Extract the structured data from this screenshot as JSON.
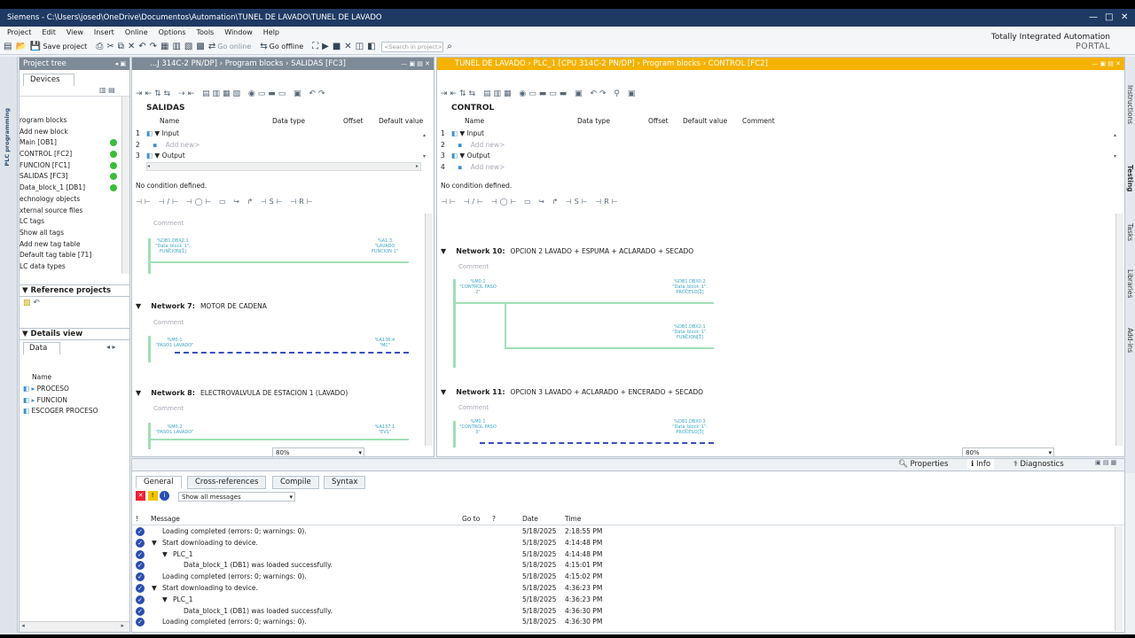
{
  "window": {
    "title": "Siemens  -  C:\\Users\\josed\\OneDrive\\Documentos\\Automation\\TUNEL DE LAVADO\\TUNEL DE LAVADO"
  },
  "menu": [
    "Project",
    "Edit",
    "View",
    "Insert",
    "Online",
    "Options",
    "Tools",
    "Window",
    "Help"
  ],
  "toolbar": {
    "save_label": "Save project",
    "go_online": "Go online",
    "go_offline": "Go offline",
    "search_placeholder": "<Search in project>"
  },
  "brand": {
    "line1": "Totally Integrated Automation",
    "line2": "PORTAL"
  },
  "sidebar_tab": "PLC programming",
  "project_tree": {
    "title": "Project tree",
    "tab": "Devices",
    "items": [
      {
        "label": "rogram blocks",
        "status": false
      },
      {
        "label": "Add new block",
        "status": false
      },
      {
        "label": "Main [OB1]",
        "status": true
      },
      {
        "label": "CONTROL [FC2]",
        "status": true
      },
      {
        "label": "FUNCION [FC1]",
        "status": true
      },
      {
        "label": "SALIDAS [FC3]",
        "status": true
      },
      {
        "label": "Data_block_1 [DB1]",
        "status": true
      },
      {
        "label": "echnology objects",
        "status": false
      },
      {
        "label": "xternal source files",
        "status": false
      },
      {
        "label": "LC tags",
        "status": false
      },
      {
        "label": "Show all tags",
        "status": false
      },
      {
        "label": "Add new tag table",
        "status": false
      },
      {
        "label": "Default tag table [71]",
        "status": false
      },
      {
        "label": "LC data types",
        "status": false
      }
    ]
  },
  "reference_projects": {
    "title": "Reference projects"
  },
  "details_view": {
    "title": "Details view",
    "tab": "Data",
    "col": "Name",
    "items": [
      "PROCESO",
      "FUNCION",
      "ESCOGER PROCESO"
    ]
  },
  "editor_left": {
    "breadcrumb": "...J 314C-2 PN/DP]  ›  Program blocks  ›  SALIDAS [FC3]",
    "block_name": "SALIDAS",
    "cols": [
      "Name",
      "Data type",
      "Offset",
      "Default value"
    ],
    "rows": [
      "Input",
      "Add new>",
      "Output"
    ],
    "condition": "No condition defined.",
    "zoom": "80%",
    "networks": [
      {
        "num": "Network 7:",
        "title": "MOTOR DE CADENA"
      },
      {
        "num": "Network 8:",
        "title": "ELECTROVALVULA DE ESTACION 1 (LAVADO)"
      }
    ],
    "comment": "Comment",
    "tags": {
      "t1": "%DB1.DBX2.1\n\"Data_block_1\".\nFUNCION[1]",
      "t2": "%A1.3\n\"LAVADO\nFUNCION 1\"",
      "t3": "%M0.1\n\"PASO1 LAVADO\"",
      "t4": "%A136.4\n\"MC\"",
      "t5": "%M0.2\n\"PASO1 LAVADO\"",
      "t6": "%A137.1\n\"EV1\""
    }
  },
  "editor_right": {
    "breadcrumb": "TUNEL DE LAVADO  ›  PLC_1 [CPU 314C-2 PN/DP]  ›  Program blocks  ›  CONTROL [FC2]",
    "block_name": "CONTROL",
    "cols": [
      "Name",
      "Data type",
      "Offset",
      "Default value",
      "Comment"
    ],
    "rows": [
      "Input",
      "Add new>",
      "Output",
      "Add new>"
    ],
    "condition": "No condition defined.",
    "zoom": "80%",
    "networks": [
      {
        "num": "Network 10:",
        "title": "OPCION 2 LAVADO + ESPUMA + ACLARADO + SECADO"
      },
      {
        "num": "Network 11:",
        "title": "OPCION 3 LAVADO + ACLARADO + ENCERADO + SECADO"
      }
    ],
    "comment": "Comment",
    "tags": {
      "t1": "%M0.1\n\"CONTROL PASO\n2\"",
      "t2": "%DB1.DBX0.2\n\"Data_block_1\".\nPROCESO[2]",
      "t3": "%DB1.DBX2.1\n\"Data_block_1\".\nFUNCION[1]",
      "t4": "%M0.1\n\"CONTROL PASO\n3\"",
      "t5": "%DB1.DBX0.3\n\"Data_block_1\".\nPROCESO[3]"
    }
  },
  "bottom_tabs": {
    "properties": "Properties",
    "info": "Info",
    "diagnostics": "Diagnostics"
  },
  "inspector_tabs": [
    "General",
    "Cross-references",
    "Compile",
    "Syntax"
  ],
  "filter": "Show all messages",
  "messages_cols": [
    "!",
    "Message",
    "Go to",
    "?",
    "Date",
    "Time"
  ],
  "messages": [
    {
      "indent": 0,
      "toggle": "",
      "text": "Loading completed (errors: 0; warnings: 0).",
      "date": "5/18/2025",
      "time": "2:18:55 PM"
    },
    {
      "indent": 0,
      "toggle": "▼",
      "text": "Start downloading to device.",
      "date": "5/18/2025",
      "time": "4:14:48 PM"
    },
    {
      "indent": 1,
      "toggle": "▼",
      "text": "PLC_1",
      "date": "5/18/2025",
      "time": "4:14:48 PM"
    },
    {
      "indent": 2,
      "toggle": "",
      "text": "Data_block_1 (DB1) was loaded successfully.",
      "date": "5/18/2025",
      "time": "4:15:01 PM"
    },
    {
      "indent": 0,
      "toggle": "",
      "text": "Loading completed (errors: 0; warnings: 0).",
      "date": "5/18/2025",
      "time": "4:15:02 PM"
    },
    {
      "indent": 0,
      "toggle": "▼",
      "text": "Start downloading to device.",
      "date": "5/18/2025",
      "time": "4:36:23 PM"
    },
    {
      "indent": 1,
      "toggle": "▼",
      "text": "PLC_1",
      "date": "5/18/2025",
      "time": "4:36:23 PM"
    },
    {
      "indent": 2,
      "toggle": "",
      "text": "Data_block_1 (DB1) was loaded successfully.",
      "date": "5/18/2025",
      "time": "4:36:30 PM"
    },
    {
      "indent": 0,
      "toggle": "",
      "text": "Loading completed (errors: 0; warnings: 0).",
      "date": "5/18/2025",
      "time": "4:36:30 PM"
    }
  ],
  "right_tabs": [
    "Instructions",
    "Testing",
    "Tasks",
    "Libraries",
    "Add-ins"
  ]
}
